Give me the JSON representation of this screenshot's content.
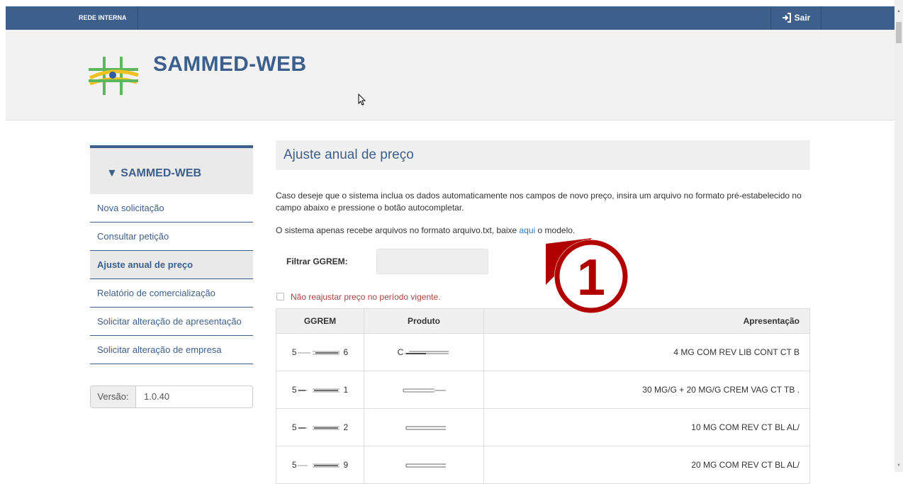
{
  "topbar": {
    "brand": "REDE INTERNA",
    "logout_label": "Sair"
  },
  "header": {
    "app_title": "SAMMED-WEB"
  },
  "sidebar": {
    "heading": "▼ SAMMED-WEB",
    "items": [
      {
        "label": "Nova solicitação"
      },
      {
        "label": "Consultar petição"
      },
      {
        "label": "Ajuste anual de preço"
      },
      {
        "label": "Relatório de comercialização"
      },
      {
        "label": "Solicitar alteração de apresentação"
      },
      {
        "label": "Solicitar alteração de empresa"
      }
    ],
    "active_item": "Ajuste anual de preço"
  },
  "version": {
    "label": "Versão:",
    "value": "1.0.40"
  },
  "main": {
    "title": "Ajuste anual de preço",
    "intro": "Caso deseje que o sistema inclua os dados automaticamente nos campos de novo preço, insira um arquivo no formato pré-estabelecido no campo abaixo e pressione o botão autocompletar.",
    "file_note_before": "O sistema apenas recebe arquivos no formato arquivo.txt, baixe ",
    "file_note_link": "aqui",
    "file_note_after": " o modelo.",
    "filter_label": "Filtrar GGREM:",
    "filter_value": "",
    "checkbox_label": "Não reajustar preço no período vigente.",
    "checkbox_checked": false
  },
  "table": {
    "headers": [
      "GGREM",
      "Produto",
      "Apresentação"
    ],
    "rows": [
      {
        "ggrem_start": "5",
        "ggrem_end": "6",
        "produto_start": "C",
        "apresentacao": "4 MG COM REV LIB CONT CT B"
      },
      {
        "ggrem_start": "5",
        "ggrem_end": "1",
        "produto_start": "",
        "apresentacao": "30 MG/G + 20 MG/G CREM VAG CT TB ."
      },
      {
        "ggrem_start": "5",
        "ggrem_end": "2",
        "produto_start": "",
        "apresentacao": "10 MG COM REV CT BL AL/"
      },
      {
        "ggrem_start": "5",
        "ggrem_end": "9",
        "produto_start": "",
        "apresentacao": "20 MG COM REV CT BL AL/"
      }
    ]
  },
  "annotation": {
    "number": "1",
    "color": "#b00000"
  },
  "colors": {
    "primary": "#3d5f8c",
    "warning_text": "#a94442"
  }
}
